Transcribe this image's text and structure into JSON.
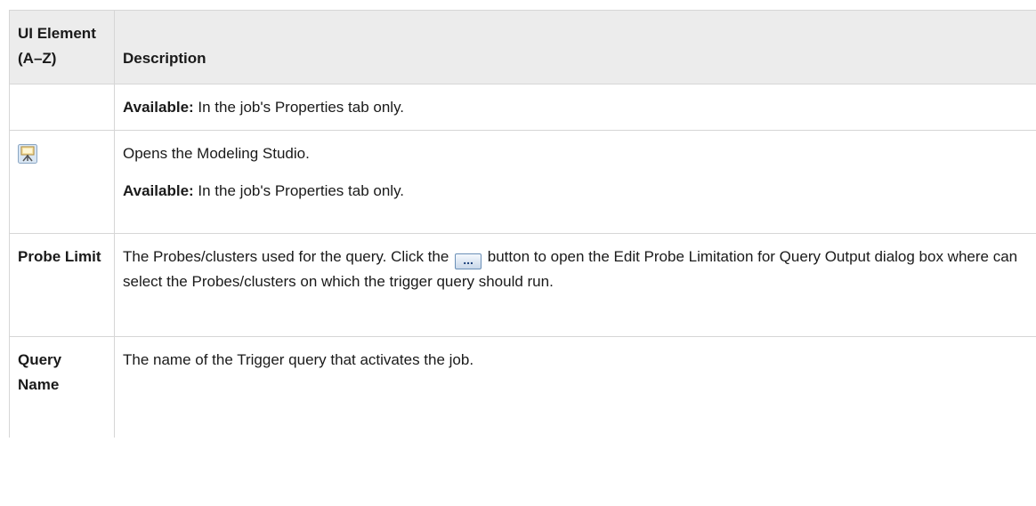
{
  "header": {
    "col1": "UI Element (A–Z)",
    "col2": "Description"
  },
  "rows": [
    {
      "element": "",
      "available_label": "Available:",
      "available_text": " In the job's Properties tab only."
    },
    {
      "element_icon": "modeling-studio-icon",
      "description": "Opens the Modeling Studio.",
      "available_label": "Available:",
      "available_text": " In the job's Properties tab only."
    },
    {
      "element": "Probe Limit",
      "desc_before": "The Probes/clusters used for the query. Click the ",
      "button_icon": "ellipsis-button-icon",
      "button_glyph": "...",
      "desc_after": " button to open the Edit Probe Limitation for Query Output dialog box where can select the Probes/clusters on which the trigger query should run."
    },
    {
      "element": "Query Name",
      "description": "The name of the Trigger query that activates the job."
    }
  ]
}
